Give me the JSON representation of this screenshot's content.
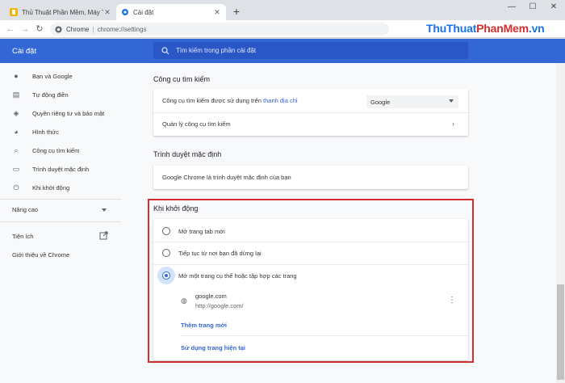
{
  "browser": {
    "tabs": [
      {
        "title": "Thủ Thuật Phần Mềm, Máy Tính",
        "icon": "site-favicon"
      },
      {
        "title": "Cài đặt",
        "icon": "gear-icon",
        "active": true
      }
    ],
    "new_tab_symbol": "+",
    "address": {
      "host": "Chrome",
      "separator": "|",
      "path": "chrome://settings"
    },
    "watermark": {
      "part1": "ThuThuat",
      "part2": "PhanMem",
      "part3": ".vn"
    }
  },
  "header": {
    "title": "Cài đặt",
    "search_placeholder": "Tìm kiếm trong phần cài đặt"
  },
  "sidebar": {
    "items": [
      {
        "label": "Bạn và Google",
        "icon": "person-icon"
      },
      {
        "label": "Tự động điền",
        "icon": "clipboard-icon"
      },
      {
        "label": "Quyền riêng tư và bảo mật",
        "icon": "shield-icon"
      },
      {
        "label": "Hình thức",
        "icon": "palette-icon"
      },
      {
        "label": "Công cụ tìm kiếm",
        "icon": "search-icon"
      },
      {
        "label": "Trình duyệt mặc định",
        "icon": "browser-icon"
      },
      {
        "label": "Khi khởi động",
        "icon": "power-icon"
      }
    ],
    "advanced": "Nâng cao",
    "extensions": "Tiện ích",
    "about": "Giới thiệu về Chrome"
  },
  "search_engine": {
    "section_title": "Công cụ tìm kiếm",
    "row1_text": "Công cụ tìm kiếm được sử dụng trên ",
    "row1_link": "thanh địa chỉ",
    "selected_engine": "Google",
    "row2_text": "Quản lý công cụ tìm kiếm"
  },
  "default_browser": {
    "section_title": "Trình duyệt mặc định",
    "status": "Google Chrome là trình duyệt mặc định của bạn"
  },
  "startup": {
    "section_title": "Khi khởi động",
    "options": [
      "Mở trang tab mới",
      "Tiếp tục từ nơi bạn đã dừng lại",
      "Mở một trang cụ thể hoặc tập hợp các trang"
    ],
    "selected_index": 2,
    "page_name": "google.com",
    "page_url": "http://google.com/",
    "add_page": "Thêm trang mới",
    "use_current": "Sử dụng trang hiện tại"
  }
}
